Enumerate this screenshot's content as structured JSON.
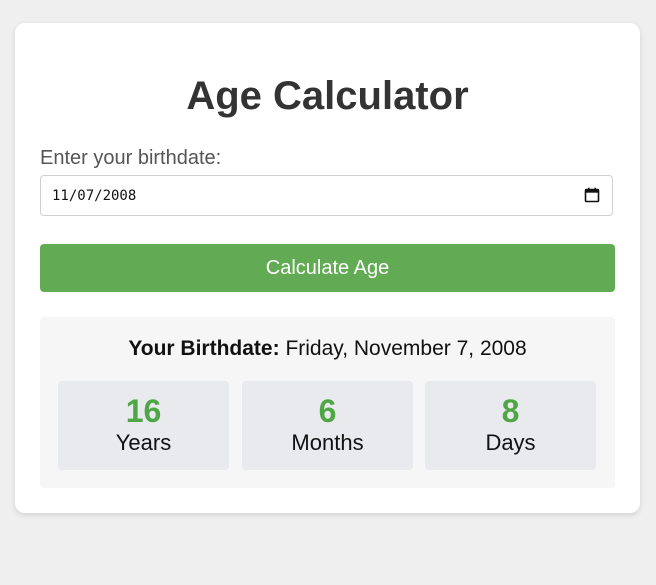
{
  "app": {
    "title": "Age Calculator"
  },
  "form": {
    "label": "Enter your birthdate:",
    "date_value": "11/07/2008",
    "calendar_icon": "calendar-icon",
    "button_label": "Calculate Age"
  },
  "result": {
    "birthdate_label": "Your Birthdate:",
    "birthdate_value": "Friday, November 7, 2008",
    "stats": [
      {
        "value": "16",
        "unit": "Years"
      },
      {
        "value": "6",
        "unit": "Months"
      },
      {
        "value": "8",
        "unit": "Days"
      }
    ]
  },
  "colors": {
    "button": "#62ab54",
    "accent": "#4ea744",
    "background": "#efefef"
  }
}
